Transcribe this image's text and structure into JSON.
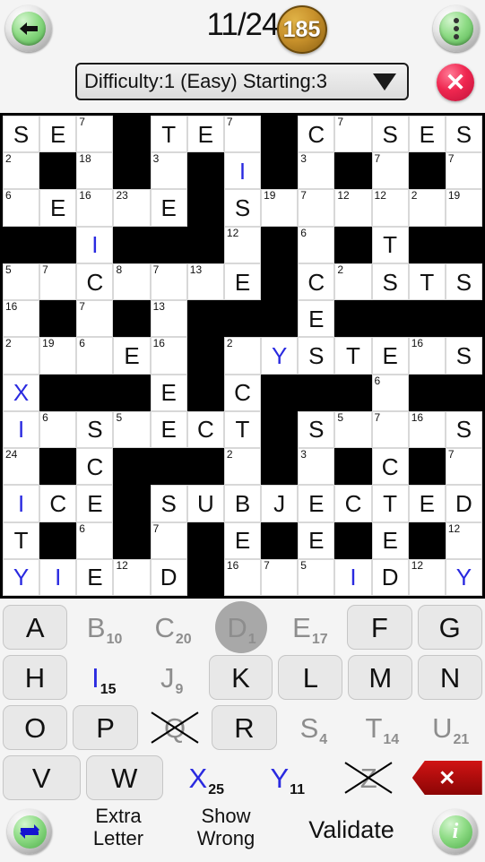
{
  "header": {
    "back_icon": "back-arrow-icon",
    "progress": "11/24",
    "coin_value": "185",
    "menu_icon": "overflow-menu-icon"
  },
  "difficulty": {
    "value": "Difficulty:1  (Easy) Starting:3",
    "caret_icon": "chevron-down-icon",
    "close_icon": "close-icon",
    "close_label": "✕"
  },
  "grid": {
    "cols": 13,
    "rows": 13,
    "cells": [
      [
        {
          "t": "l",
          "v": "S"
        },
        {
          "t": "l",
          "v": "E"
        },
        {
          "t": "n",
          "v": "7"
        },
        {
          "t": "b"
        },
        {
          "t": "l",
          "v": "T"
        },
        {
          "t": "l",
          "v": "E"
        },
        {
          "t": "n",
          "v": "7"
        },
        {
          "t": "b"
        },
        {
          "t": "l",
          "v": "C"
        },
        {
          "t": "n",
          "v": "7"
        },
        {
          "t": "l",
          "v": "S"
        },
        {
          "t": "l",
          "v": "E"
        },
        {
          "t": "l",
          "v": "S"
        }
      ],
      [
        {
          "t": "n",
          "v": "2"
        },
        {
          "t": "b"
        },
        {
          "t": "n",
          "v": "18"
        },
        {
          "t": "b"
        },
        {
          "t": "n",
          "v": "3"
        },
        {
          "t": "b"
        },
        {
          "t": "l",
          "v": "I",
          "c": "blue"
        },
        {
          "t": "b"
        },
        {
          "t": "n",
          "v": "3"
        },
        {
          "t": "b"
        },
        {
          "t": "n",
          "v": "7"
        },
        {
          "t": "b"
        },
        {
          "t": "n",
          "v": "7"
        }
      ],
      [
        {
          "t": "n",
          "v": "6"
        },
        {
          "t": "l",
          "v": "E"
        },
        {
          "t": "n",
          "v": "16"
        },
        {
          "t": "n",
          "v": "23"
        },
        {
          "t": "l",
          "v": "E"
        },
        {
          "t": "b"
        },
        {
          "t": "l",
          "v": "S"
        },
        {
          "t": "n",
          "v": "19"
        },
        {
          "t": "n",
          "v": "7"
        },
        {
          "t": "n",
          "v": "12"
        },
        {
          "t": "n",
          "v": "12"
        },
        {
          "t": "n",
          "v": "2"
        },
        {
          "t": "n",
          "v": "19"
        }
      ],
      [
        {
          "t": "b"
        },
        {
          "t": "b"
        },
        {
          "t": "l",
          "v": "I",
          "c": "blue"
        },
        {
          "t": "b"
        },
        {
          "t": "b"
        },
        {
          "t": "b"
        },
        {
          "t": "n",
          "v": "12"
        },
        {
          "t": "b"
        },
        {
          "t": "n",
          "v": "6"
        },
        {
          "t": "b"
        },
        {
          "t": "l",
          "v": "T"
        },
        {
          "t": "b"
        },
        {
          "t": "b"
        }
      ],
      [
        {
          "t": "n",
          "v": "5"
        },
        {
          "t": "n",
          "v": "7"
        },
        {
          "t": "l",
          "v": "C"
        },
        {
          "t": "n",
          "v": "8"
        },
        {
          "t": "n",
          "v": "7"
        },
        {
          "t": "n",
          "v": "13"
        },
        {
          "t": "l",
          "v": "E"
        },
        {
          "t": "b"
        },
        {
          "t": "l",
          "v": "C"
        },
        {
          "t": "n",
          "v": "2"
        },
        {
          "t": "l",
          "v": "S"
        },
        {
          "t": "l",
          "v": "T"
        },
        {
          "t": "l",
          "v": "S"
        }
      ],
      [
        {
          "t": "n",
          "v": "16"
        },
        {
          "t": "b"
        },
        {
          "t": "n",
          "v": "7"
        },
        {
          "t": "b"
        },
        {
          "t": "n",
          "v": "13"
        },
        {
          "t": "b"
        },
        {
          "t": "b"
        },
        {
          "t": "b"
        },
        {
          "t": "l",
          "v": "E"
        },
        {
          "t": "b"
        },
        {
          "t": "b"
        },
        {
          "t": "b"
        },
        {
          "t": "b"
        }
      ],
      [
        {
          "t": "n",
          "v": "2"
        },
        {
          "t": "n",
          "v": "19"
        },
        {
          "t": "n",
          "v": "6"
        },
        {
          "t": "l",
          "v": "E"
        },
        {
          "t": "n",
          "v": "16"
        },
        {
          "t": "b"
        },
        {
          "t": "n",
          "v": "2"
        },
        {
          "t": "l",
          "v": "Y",
          "c": "blue"
        },
        {
          "t": "l",
          "v": "S"
        },
        {
          "t": "l",
          "v": "T"
        },
        {
          "t": "l",
          "v": "E"
        },
        {
          "t": "n",
          "v": "16"
        },
        {
          "t": "l",
          "v": "S"
        }
      ],
      [
        {
          "t": "l",
          "v": "X",
          "c": "blue"
        },
        {
          "t": "b"
        },
        {
          "t": "b"
        },
        {
          "t": "b"
        },
        {
          "t": "l",
          "v": "E"
        },
        {
          "t": "b"
        },
        {
          "t": "l",
          "v": "C"
        },
        {
          "t": "b"
        },
        {
          "t": "b"
        },
        {
          "t": "b"
        },
        {
          "t": "n",
          "v": "6"
        },
        {
          "t": "b"
        },
        {
          "t": "b"
        }
      ],
      [
        {
          "t": "l",
          "v": "I",
          "c": "blue"
        },
        {
          "t": "n",
          "v": "6"
        },
        {
          "t": "l",
          "v": "S"
        },
        {
          "t": "n",
          "v": "5"
        },
        {
          "t": "l",
          "v": "E"
        },
        {
          "t": "l",
          "v": "C"
        },
        {
          "t": "l",
          "v": "T"
        },
        {
          "t": "b"
        },
        {
          "t": "l",
          "v": "S"
        },
        {
          "t": "n",
          "v": "5"
        },
        {
          "t": "n",
          "v": "7"
        },
        {
          "t": "n",
          "v": "16"
        },
        {
          "t": "l",
          "v": "S"
        }
      ],
      [
        {
          "t": "n",
          "v": "24"
        },
        {
          "t": "b"
        },
        {
          "t": "l",
          "v": "C"
        },
        {
          "t": "b"
        },
        {
          "t": "b"
        },
        {
          "t": "b"
        },
        {
          "t": "n",
          "v": "2"
        },
        {
          "t": "b"
        },
        {
          "t": "n",
          "v": "3"
        },
        {
          "t": "b"
        },
        {
          "t": "l",
          "v": "C"
        },
        {
          "t": "b"
        },
        {
          "t": "n",
          "v": "7"
        }
      ],
      [
        {
          "t": "l",
          "v": "I",
          "c": "blue"
        },
        {
          "t": "l",
          "v": "C"
        },
        {
          "t": "l",
          "v": "E"
        },
        {
          "t": "b"
        },
        {
          "t": "l",
          "v": "S"
        },
        {
          "t": "l",
          "v": "U"
        },
        {
          "t": "l",
          "v": "B"
        },
        {
          "t": "l",
          "v": "J"
        },
        {
          "t": "l",
          "v": "E"
        },
        {
          "t": "l",
          "v": "C"
        },
        {
          "t": "l",
          "v": "T"
        },
        {
          "t": "l",
          "v": "E"
        },
        {
          "t": "l",
          "v": "D"
        }
      ],
      [
        {
          "t": "l",
          "v": "T"
        },
        {
          "t": "b"
        },
        {
          "t": "n",
          "v": "6"
        },
        {
          "t": "b"
        },
        {
          "t": "n",
          "v": "7"
        },
        {
          "t": "b"
        },
        {
          "t": "l",
          "v": "E"
        },
        {
          "t": "b"
        },
        {
          "t": "l",
          "v": "E"
        },
        {
          "t": "b"
        },
        {
          "t": "l",
          "v": "E"
        },
        {
          "t": "b"
        },
        {
          "t": "n",
          "v": "12"
        }
      ],
      [
        {
          "t": "l",
          "v": "Y",
          "c": "blue"
        },
        {
          "t": "l",
          "v": "I",
          "c": "blue"
        },
        {
          "t": "l",
          "v": "E"
        },
        {
          "t": "n",
          "v": "12"
        },
        {
          "t": "l",
          "v": "D"
        },
        {
          "t": "b"
        },
        {
          "t": "n",
          "v": "16"
        },
        {
          "t": "n",
          "v": "7"
        },
        {
          "t": "n",
          "v": "5"
        },
        {
          "t": "l",
          "v": "I",
          "c": "blue"
        },
        {
          "t": "l",
          "v": "D"
        },
        {
          "t": "n",
          "v": "12"
        },
        {
          "t": "l",
          "v": "Y",
          "c": "blue"
        }
      ]
    ]
  },
  "keyboard": {
    "rows": [
      [
        {
          "letter": "A",
          "num": "",
          "state": "available"
        },
        {
          "letter": "B",
          "num": "10",
          "state": "used"
        },
        {
          "letter": "C",
          "num": "20",
          "state": "used"
        },
        {
          "letter": "D",
          "num": "1",
          "state": "selected"
        },
        {
          "letter": "E",
          "num": "17",
          "state": "used"
        },
        {
          "letter": "F",
          "num": "",
          "state": "available"
        },
        {
          "letter": "G",
          "num": "",
          "state": "available"
        }
      ],
      [
        {
          "letter": "H",
          "num": "",
          "state": "available"
        },
        {
          "letter": "I",
          "num": "15",
          "state": "used-blue"
        },
        {
          "letter": "J",
          "num": "9",
          "state": "used"
        },
        {
          "letter": "K",
          "num": "",
          "state": "available"
        },
        {
          "letter": "L",
          "num": "",
          "state": "available"
        },
        {
          "letter": "M",
          "num": "",
          "state": "available"
        },
        {
          "letter": "N",
          "num": "",
          "state": "available"
        }
      ],
      [
        {
          "letter": "O",
          "num": "",
          "state": "available"
        },
        {
          "letter": "P",
          "num": "",
          "state": "available"
        },
        {
          "letter": "Q",
          "num": "",
          "state": "crossed"
        },
        {
          "letter": "R",
          "num": "",
          "state": "available"
        },
        {
          "letter": "S",
          "num": "4",
          "state": "used"
        },
        {
          "letter": "T",
          "num": "14",
          "state": "used"
        },
        {
          "letter": "U",
          "num": "21",
          "state": "used"
        }
      ],
      [
        {
          "letter": "V",
          "num": "",
          "state": "available"
        },
        {
          "letter": "W",
          "num": "",
          "state": "available"
        },
        {
          "letter": "X",
          "num": "25",
          "state": "used-blue"
        },
        {
          "letter": "Y",
          "num": "11",
          "state": "used-blue"
        },
        {
          "letter": "Z",
          "num": "",
          "state": "crossed"
        },
        {
          "letter": "",
          "num": "",
          "state": "delete"
        }
      ]
    ],
    "delete_icon": "delete-key-icon",
    "delete_label": "✕"
  },
  "toolbar": {
    "swap_icon": "swap-arrows-icon",
    "extra_letter_label": "Extra\nLetter",
    "extra_letter_line1": "Extra",
    "extra_letter_line2": "Letter",
    "show_wrong_line1": "Show",
    "show_wrong_line2": "Wrong",
    "validate_label": "Validate",
    "info_icon": "info-icon",
    "info_label": "i"
  },
  "colors": {
    "blue_letter": "#2a2ae0",
    "grey_letter": "#8d8d8d",
    "accent_green": "#4fae4b",
    "accent_red": "#ef2750",
    "coin_gold": "#c9922c"
  }
}
